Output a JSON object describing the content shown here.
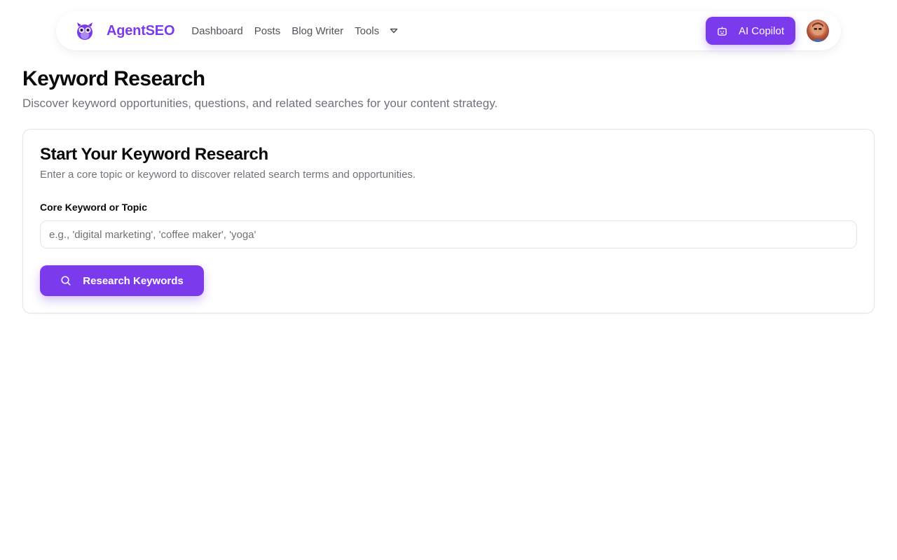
{
  "brand": {
    "name": "AgentSEO",
    "logo_icon": "owl-icon",
    "accent": "#7c3aed"
  },
  "nav": {
    "links": [
      "Dashboard",
      "Posts",
      "Blog Writer",
      "Tools"
    ],
    "tools_icon": "chevron-down-icon",
    "copilot_label": "AI Copilot",
    "copilot_icon": "bot-icon",
    "avatar": "user-avatar"
  },
  "page": {
    "title": "Keyword Research",
    "subtitle": "Discover keyword opportunities, questions, and related searches for your content strategy."
  },
  "card": {
    "title": "Start Your Keyword Research",
    "description": "Enter a core topic or keyword to discover related search terms and opportunities.",
    "field_label": "Core Keyword or Topic",
    "input_value": "",
    "input_placeholder": "e.g., 'digital marketing', 'coffee maker', 'yoga'",
    "button_label": "Research Keywords",
    "button_icon": "search-icon"
  }
}
